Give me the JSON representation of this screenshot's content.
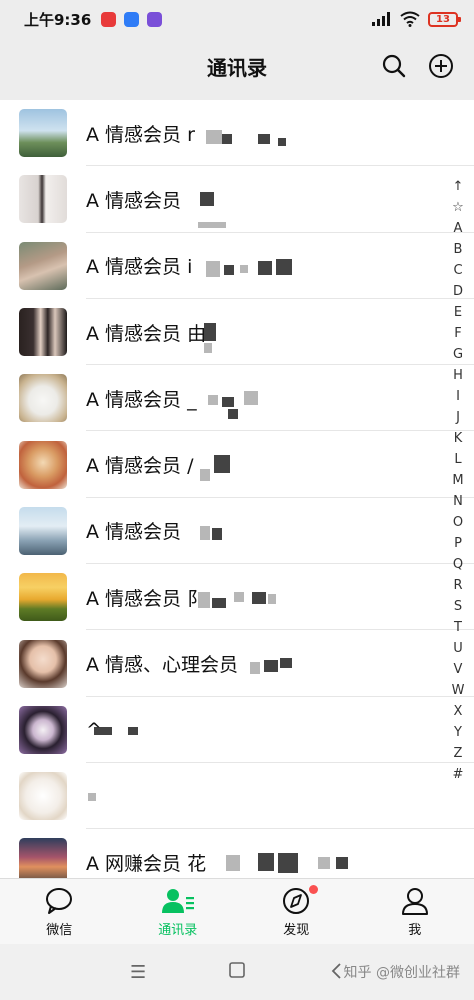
{
  "status_bar": {
    "time": "上午9:36",
    "battery": "13"
  },
  "header": {
    "title": "通讯录",
    "search_icon": "search-icon",
    "add_icon": "plus-circle-icon"
  },
  "contacts": [
    {
      "label": "A 情感会员 r"
    },
    {
      "label": "A 情感会员"
    },
    {
      "label": "A 情感会员 i"
    },
    {
      "label": "A 情感会员 由"
    },
    {
      "label": "A 情感会员 _"
    },
    {
      "label": "A 情感会员 /"
    },
    {
      "label": "A 情感会员"
    },
    {
      "label": "A 情感会员 阝"
    },
    {
      "label": "A 情感、心理会员"
    },
    {
      "label": "^"
    },
    {
      "label": ""
    },
    {
      "label": "A 网赚会员 花"
    }
  ],
  "index_bar": [
    "↑",
    "☆",
    "A",
    "B",
    "C",
    "D",
    "E",
    "F",
    "G",
    "H",
    "I",
    "J",
    "K",
    "L",
    "M",
    "N",
    "O",
    "P",
    "Q",
    "R",
    "S",
    "T",
    "U",
    "V",
    "W",
    "X",
    "Y",
    "Z",
    "#"
  ],
  "tabs": [
    {
      "label": "微信",
      "icon": "chat-bubble-icon"
    },
    {
      "label": "通讯录",
      "icon": "contacts-icon"
    },
    {
      "label": "发现",
      "icon": "compass-icon"
    },
    {
      "label": "我",
      "icon": "person-icon"
    }
  ],
  "colors": {
    "accent": "#07c160",
    "badge": "#fa5151"
  },
  "watermark": "知乎 @微创业社群"
}
